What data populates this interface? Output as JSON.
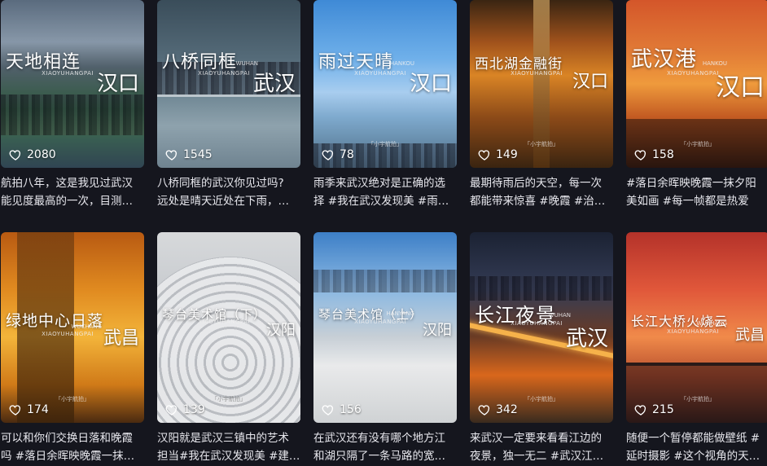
{
  "cards": [
    {
      "title_main": "天地相连",
      "title_sub": "XIAOYUHANGPAI",
      "title_pin": "",
      "title_city": "汉口",
      "watermark": "",
      "likes": "2080",
      "caption_line1": "航拍八年，这是我见过武汉",
      "caption_line2": "能见度最高的一次，目测…"
    },
    {
      "title_main": "八桥同框",
      "title_sub": "XIAOYUHANGPAI",
      "title_pin": "WUHAN",
      "title_city": "武汉",
      "watermark": "",
      "likes": "1545",
      "caption_line1": "八桥同框的武汉你见过吗?",
      "caption_line2": "远处是晴天近处在下雨，…"
    },
    {
      "title_main": "雨过天晴",
      "title_sub": "XIAOYUHANGPAI",
      "title_pin": "HANKOU",
      "title_city": "汉口",
      "watermark": "「小宇航拍」",
      "likes": "78",
      "caption_line1": "雨季来武汉绝对是正确的选",
      "caption_line2": "择 #我在武汉发现美 #雨…"
    },
    {
      "title_main": "西北湖金融街",
      "title_sub": "XIAOYUHANGPAI",
      "title_pin": "",
      "title_city": "汉口",
      "watermark": "「小宇航拍」",
      "likes": "149",
      "caption_line1": "最期待雨后的天空，每一次",
      "caption_line2": "都能带来惊喜 #晚霞 #治…"
    },
    {
      "title_main": "武汉港",
      "title_sub": "XIAOYUHANGPAI",
      "title_pin": "HANKOU",
      "title_city": "汉口",
      "watermark": "「小宇航拍」",
      "likes": "158",
      "caption_line1": "#落日余晖映晚霞一抹夕阳",
      "caption_line2": "美如画 #每一帧都是热爱"
    },
    {
      "title_main": "绿地中心日落",
      "title_sub": "XIAOYUHANGPAI",
      "title_pin": "WUCHANG",
      "title_city": "武昌",
      "watermark": "「小宇航拍」",
      "likes": "174",
      "caption_line1": "可以和你们交换日落和晚霞",
      "caption_line2": "吗 #落日余晖映晚霞一抹…"
    },
    {
      "title_main": "琴台美术馆（下）",
      "title_sub": "XIAOYUHANGPAI",
      "title_pin": "",
      "title_city": "汉阳",
      "watermark": "「小宇航拍」",
      "likes": "139",
      "caption_line1": "汉阳就是武汉三镇中的艺术",
      "caption_line2": "担当#我在武汉发现美 #建…"
    },
    {
      "title_main": "琴台美术馆（上）",
      "title_sub": "XIAOYUHANGPAI",
      "title_pin": "HANYANG",
      "title_city": "汉阳",
      "watermark": "",
      "likes": "156",
      "caption_line1": "在武汉还有没有哪个地方江",
      "caption_line2": "和湖只隔了一条马路的宽…"
    },
    {
      "title_main": "长江夜景",
      "title_sub": "XIAOYUHANGPAI",
      "title_pin": "WUHAN",
      "title_city": "武汉",
      "watermark": "「小宇航拍」",
      "likes": "342",
      "caption_line1": "来武汉一定要来看看江边的",
      "caption_line2": "夜景，独一无二 #武汉江…"
    },
    {
      "title_main": "长江大桥火烧云",
      "title_sub": "XIAOYUHANGPAI",
      "title_pin": "WUCHANG",
      "title_city": "武昌",
      "watermark": "「小宇航拍」",
      "likes": "215",
      "caption_line1": "随便一个暂停都能做壁纸 #",
      "caption_line2": "延时摄影 #这个视角的天…"
    }
  ]
}
